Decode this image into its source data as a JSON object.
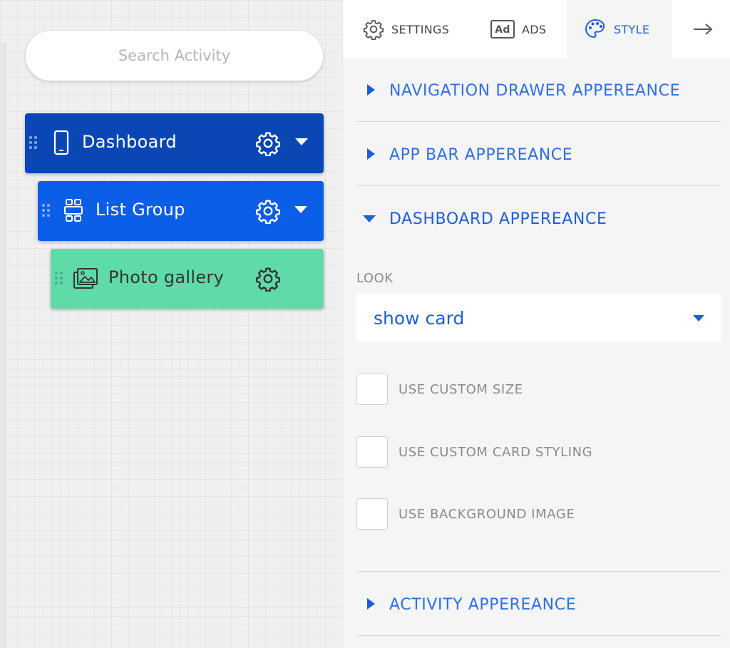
{
  "canvas": {
    "search": {
      "placeholder": "Search Activity"
    },
    "items": [
      {
        "label": "Dashboard",
        "type_icon": "phone-icon"
      },
      {
        "label": "List Group",
        "type_icon": "list-group-icon"
      },
      {
        "label": "Photo gallery",
        "type_icon": "photo-gallery-icon"
      }
    ]
  },
  "panel": {
    "tabs": [
      {
        "label": "SETTINGS",
        "icon": "gear-icon"
      },
      {
        "label": "ADS",
        "icon": "ad-icon"
      },
      {
        "label": "STYLE",
        "icon": "palette-icon",
        "active": true
      },
      {
        "label": "",
        "icon": "arrow-right-icon"
      }
    ],
    "sections": [
      {
        "title": "NAVIGATION DRAWER APPEREANCE",
        "open": false
      },
      {
        "title": "APP BAR APPEREANCE",
        "open": false
      },
      {
        "title": "DASHBOARD APPEREANCE",
        "open": true
      },
      {
        "title": "ACTIVITY APPEREANCE",
        "open": false
      }
    ],
    "dashboard": {
      "look_label": "LOOK",
      "look_value": "show card",
      "checkboxes": [
        {
          "label": "USE CUSTOM SIZE",
          "checked": false
        },
        {
          "label": "USE CUSTOM CARD STYLING",
          "checked": false
        },
        {
          "label": "USE BACKGROUND IMAGE",
          "checked": false
        }
      ]
    }
  },
  "colors": {
    "dashboard_item": "#0a47b5",
    "list_group_item": "#0a5ee8",
    "photo_item": "#5fdaa9",
    "accent": "#1b5fd6"
  }
}
